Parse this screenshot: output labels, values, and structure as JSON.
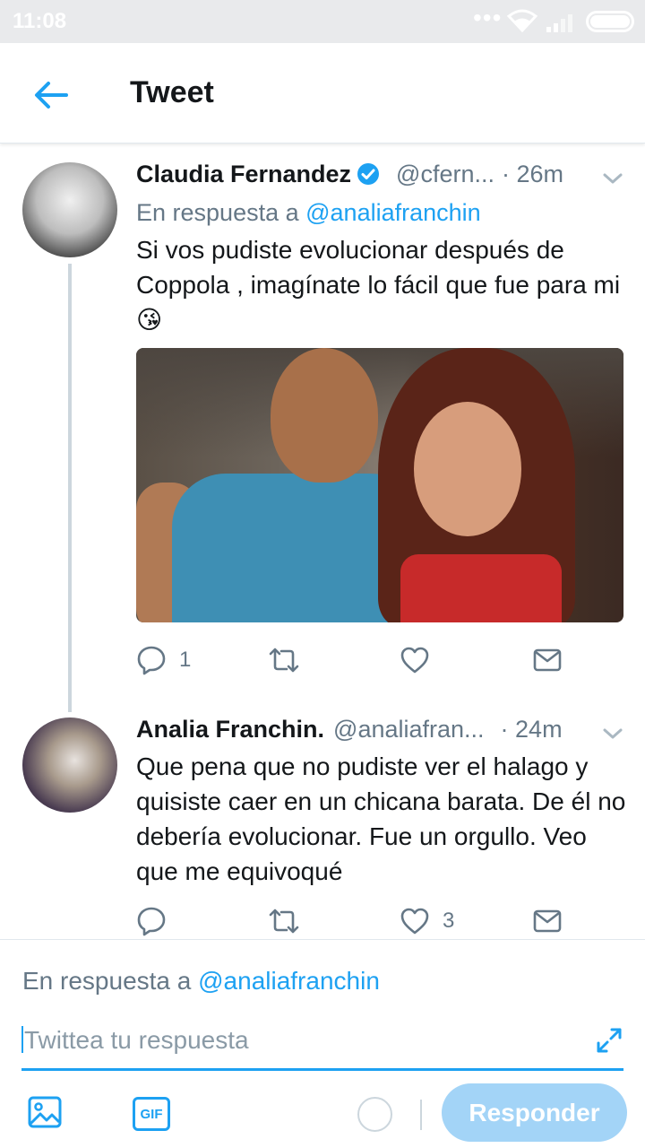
{
  "status_bar": {
    "time": "11:08"
  },
  "appbar": {
    "title": "Tweet"
  },
  "tweets": [
    {
      "name": "Claudia Fernandez",
      "handle": "@cfern...",
      "time": "· 26m",
      "reply_prefix": "En respuesta a ",
      "reply_mention": "@analiafranchin",
      "text": "Si vos pudiste evolucionar después de Coppola , imagínate lo fácil que fue para mi",
      "emoji": "😘",
      "actions": {
        "replies": "1",
        "retweets": "",
        "likes": ""
      }
    },
    {
      "name": "Analia Franchin.",
      "handle": "@analiafran...",
      "time": "· 24m",
      "text": "Que pena que no pudiste ver el halago y quisiste caer en un chicana barata. De él no debería evolucionar. Fue un orgullo. Veo que me equivoqué",
      "actions": {
        "replies": "",
        "retweets": "",
        "likes": "3"
      }
    }
  ],
  "composer": {
    "reply_prefix": "En respuesta a ",
    "reply_mention": "@analiafranchin",
    "placeholder": "Twittea tu respuesta",
    "gif_label": "GIF",
    "send_label": "Responder"
  },
  "colors": {
    "accent": "#1da1f2",
    "muted": "#657786",
    "send_disabled": "#a3d4f7"
  }
}
